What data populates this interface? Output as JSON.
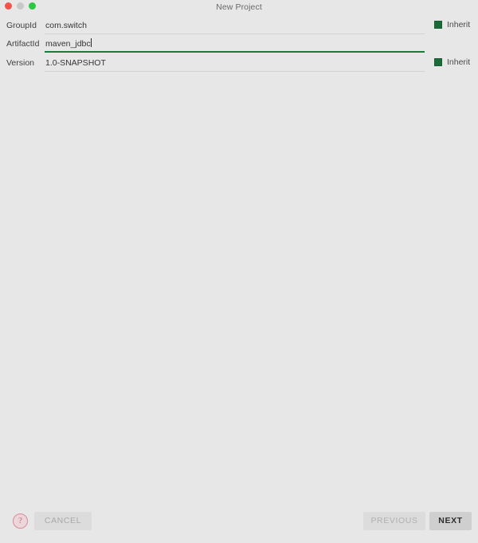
{
  "window": {
    "title": "New Project",
    "traffic_lights": [
      {
        "name": "close",
        "color": "#f0544a"
      },
      {
        "name": "minimize",
        "color": "#c8c8c8"
      },
      {
        "name": "zoom",
        "color": "#2bc940"
      }
    ]
  },
  "form": {
    "rows": [
      {
        "label": "GroupId",
        "value": "com.switch",
        "focused": false,
        "inherit": {
          "label": "Inherit",
          "checked": true
        }
      },
      {
        "label": "ArtifactId",
        "value": "maven_jdbc",
        "focused": true,
        "inherit": null
      },
      {
        "label": "Version",
        "value": "1.0-SNAPSHOT",
        "focused": false,
        "inherit": {
          "label": "Inherit",
          "checked": true
        }
      }
    ]
  },
  "footer": {
    "help": "?",
    "cancel": "CANCEL",
    "previous": "PREVIOUS",
    "next": "NEXT"
  },
  "colors": {
    "background": "#e7e7e7",
    "focus_accent": "#1d7a3e",
    "checkbox_fill": "#1a6b38",
    "help_accent": "#c06b80"
  }
}
